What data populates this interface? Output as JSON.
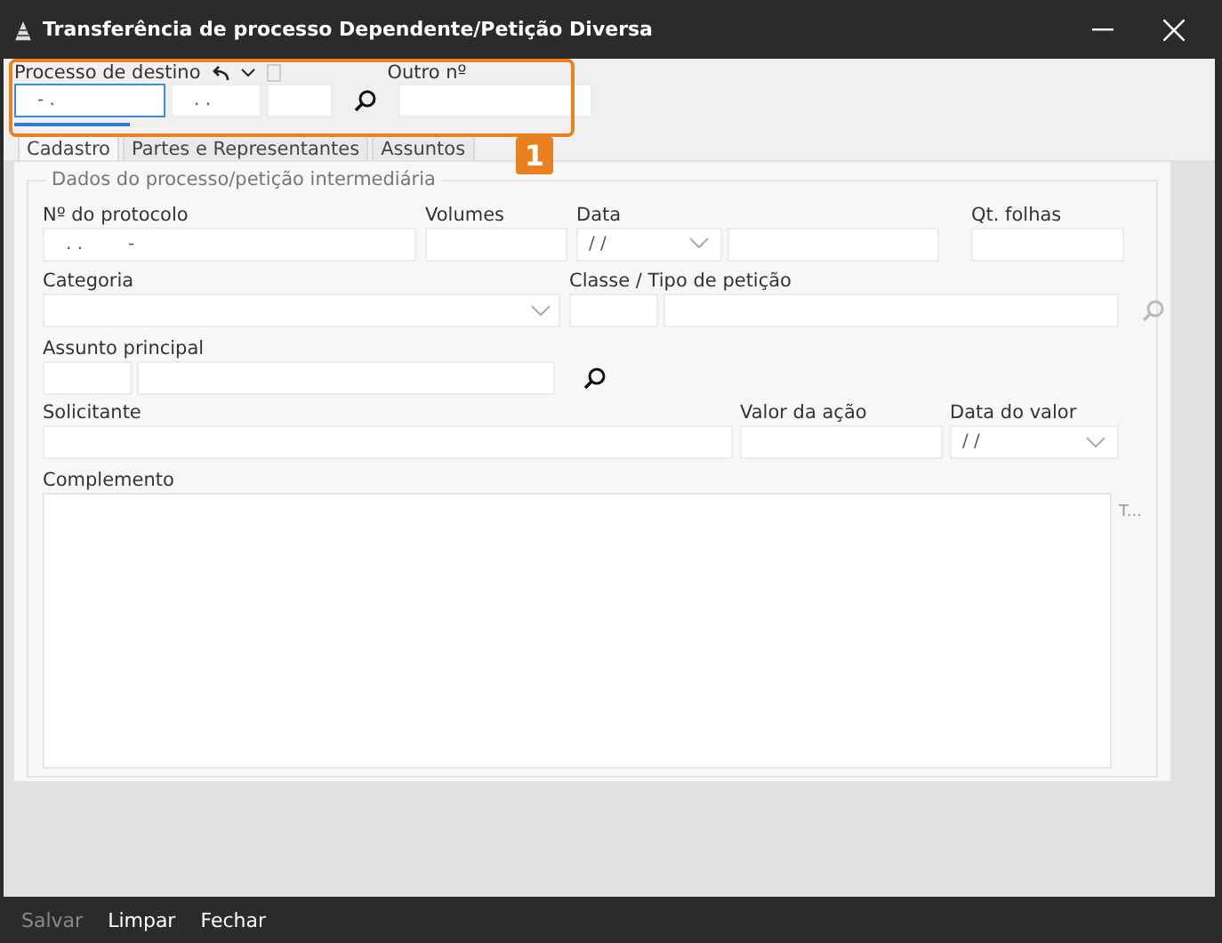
{
  "window": {
    "title": "Transferência de processo Dependente/Petição Diversa"
  },
  "destination": {
    "label": "Processo de destino",
    "fields": [
      {
        "value": "- .",
        "focused": true
      },
      {
        "value": ". .",
        "focused": false
      },
      {
        "focused": false
      }
    ],
    "other_label": "Outro nº"
  },
  "callout": {
    "number": "1"
  },
  "tabs": [
    {
      "label": "Cadastro",
      "selected": true
    },
    {
      "label": "Partes e Representantes",
      "selected": false
    },
    {
      "label": "Assuntos",
      "selected": false
    }
  ],
  "group": {
    "title": "Dados do processo/petição intermediária"
  },
  "fields": {
    "protocolo": {
      "label": "Nº do protocolo",
      "value": ". .        -"
    },
    "volumes": {
      "label": "Volumes"
    },
    "data": {
      "label": "Data",
      "value": "/ /"
    },
    "qt_folhas": {
      "label": "Qt. folhas"
    },
    "categoria": {
      "label": "Categoria"
    },
    "classe": {
      "label": "Classe / Tipo de petição"
    },
    "assunto": {
      "label": "Assunto principal"
    },
    "solicitante": {
      "label": "Solicitante"
    },
    "valor": {
      "label": "Valor da ação"
    },
    "data_valor": {
      "label": "Data do valor",
      "value": "/ /"
    },
    "complemento": {
      "label": "Complemento",
      "side_text": "T..."
    }
  },
  "footer": [
    {
      "label": "Salvar",
      "disabled": true
    },
    {
      "label": "Limpar",
      "disabled": false
    },
    {
      "label": "Fechar",
      "disabled": false
    }
  ]
}
